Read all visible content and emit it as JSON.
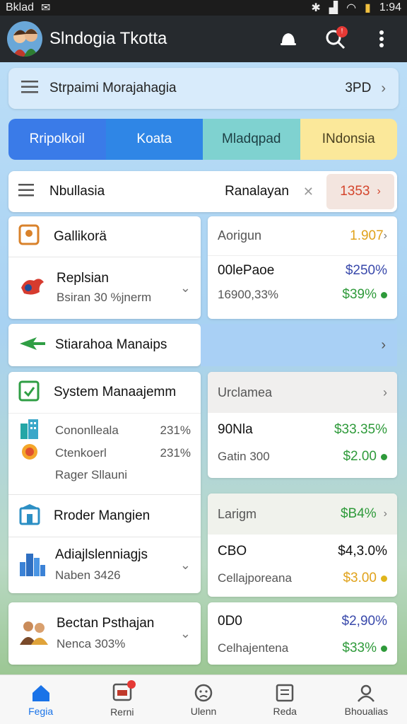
{
  "statusbar": {
    "left": "Bklad",
    "time": "1:94"
  },
  "app": {
    "title": "Slndogia Tkotta"
  },
  "search": {
    "text": "Strpaimi Morajahagia",
    "value": "3PD"
  },
  "tabs": [
    {
      "label": "Rripolkoil",
      "bg": "#3a7be8",
      "color": "#ffffff"
    },
    {
      "label": "Koata",
      "bg": "#2f86e6",
      "color": "#ffffff"
    },
    {
      "label": "Mladqpad",
      "bg": "#7fd2d0",
      "color": "#1d3f44"
    },
    {
      "label": "INdonsia",
      "bg": "#fbe89a",
      "color": "#4a4020"
    }
  ],
  "filter": {
    "label": "Nbullasia",
    "middle": "Ranalayan",
    "value": "1353"
  },
  "left_items": {
    "i1": "Gallikorä",
    "i2": {
      "title": "Replsian",
      "sub": "Bsiran 30 %jnerm"
    },
    "i3": "Stiarahoa Manaips",
    "i4": "System Manaajemm",
    "i5a": {
      "label": "Cononlleala",
      "pct": "231%"
    },
    "i5b": {
      "label": "Ctenkoerl",
      "pct": "231%"
    },
    "i5c": "Rager Sllauni",
    "i6": "Rroder Mangien",
    "i7": {
      "title": "Adiajlslenniagjs",
      "sub": "Naben 3426"
    },
    "i8": {
      "title": "Bectan Psthajan",
      "sub": "Nenca 303%"
    }
  },
  "cards": [
    {
      "header": "Aorigun",
      "hvalue": "1.907",
      "r1l": "00lePaoe",
      "r1v": "$250%",
      "r2l": "16900,33%",
      "r2v": "$39%"
    },
    {
      "header": "Urclamea",
      "hvalue": "",
      "r1l": "90Nla",
      "r1v": "$33.35%",
      "r2l": "Gatin 300",
      "r2v": "$2.00"
    },
    {
      "header": "Larigm",
      "hvalue": "$B4%",
      "r1l": "CBO",
      "r1v": "$4,3.0%",
      "r2l": "Cellajporeana",
      "r2v": "$3.00"
    },
    {
      "header": "",
      "hvalue": "",
      "r1l": "0D0",
      "r1v": "$2,90%",
      "r2l": "Celhajentena",
      "r2v": "$33%"
    }
  ],
  "nav": [
    {
      "label": "Fegia",
      "active": true
    },
    {
      "label": "Rerni"
    },
    {
      "label": "Ulenn"
    },
    {
      "label": "Reda"
    },
    {
      "label": "Bhoualias"
    }
  ]
}
